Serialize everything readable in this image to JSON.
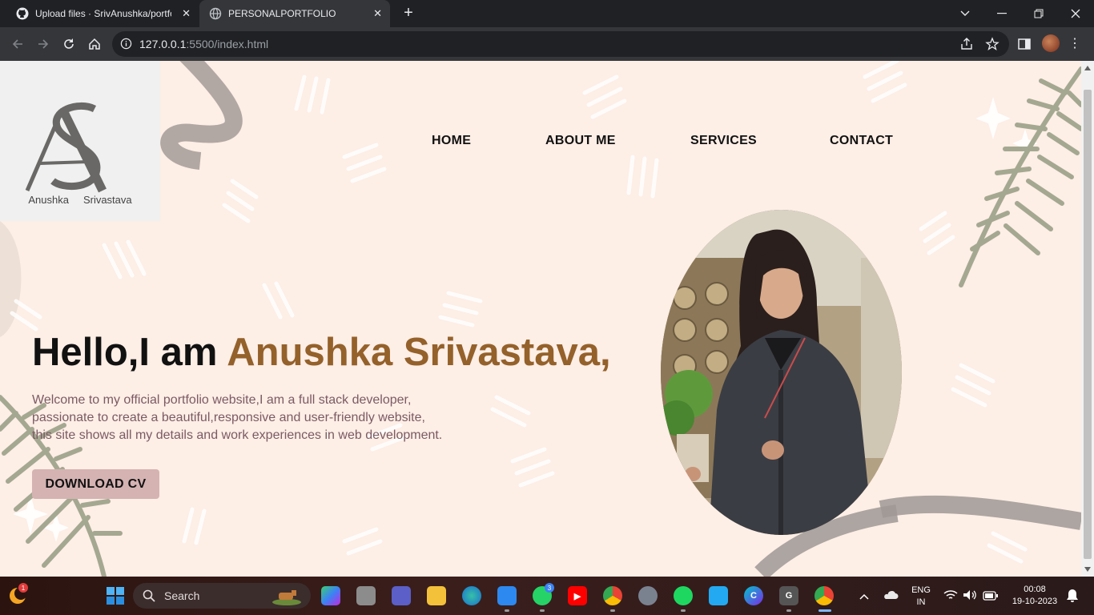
{
  "browser": {
    "tabs": [
      {
        "title": "Upload files · SrivAnushka/portfolio",
        "active": false,
        "icon": "github-icon"
      },
      {
        "title": "PERSONALPORTFOLIO",
        "active": true,
        "icon": "globe-icon"
      }
    ],
    "url_host": "127.0.0.1",
    "url_rest": ":5500/index.html"
  },
  "site": {
    "logo": {
      "first": "Anushka",
      "last": "Srivastava"
    },
    "nav": [
      "HOME",
      "ABOUT ME",
      "SERVICES",
      "CONTACT"
    ],
    "hero": {
      "greeting": "Hello,I am ",
      "name": "Anushka Srivastava,",
      "desc_lines": [
        "Welcome to my official portfolio website,I am a full stack developer,",
        "passionate to create a beautiful,responsive and user-friendly website,",
        "this site shows all my details and work experiences in web development."
      ],
      "cta": "DOWNLOAD CV"
    },
    "colors": {
      "background": "#fdeee6",
      "accent": "#94612b",
      "button": "#d5b3b2"
    }
  },
  "taskbar": {
    "search_label": "Search",
    "weather_badge": "1",
    "whatsapp_badge": "3",
    "lang_line1": "ENG",
    "lang_line2": "IN",
    "time": "00:08",
    "date": "19-10-2023"
  }
}
